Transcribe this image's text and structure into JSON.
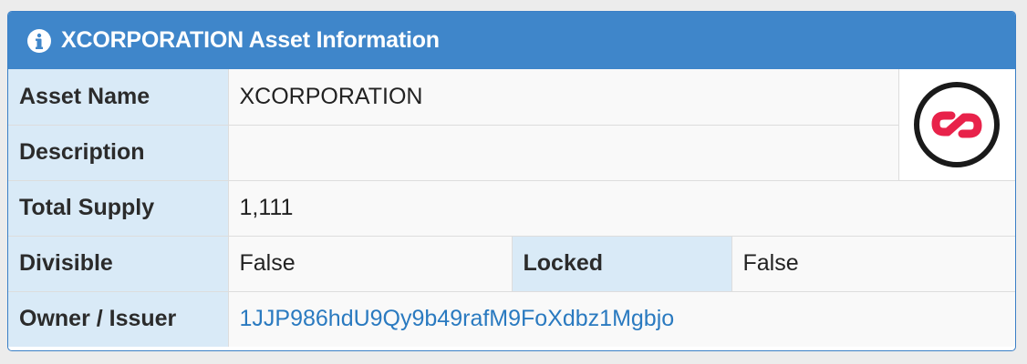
{
  "panel": {
    "title": "XCORPORATION Asset Information",
    "icon": "info-icon"
  },
  "rows": {
    "asset_name": {
      "label": "Asset Name",
      "value": "XCORPORATION"
    },
    "description": {
      "label": "Description",
      "value": ""
    },
    "total_supply": {
      "label": "Total Supply",
      "value": "1,111"
    },
    "divisible": {
      "label": "Divisible",
      "value": "False"
    },
    "locked": {
      "label": "Locked",
      "value": "False"
    },
    "owner": {
      "label": "Owner / Issuer",
      "value": "1JJP986hdU9Qy9b49rafM9FoXdbz1Mgbjo"
    }
  },
  "logo": {
    "icon": "asset-logo-icon",
    "color": "#e8224a"
  },
  "colors": {
    "header": "#3f86ca",
    "label_bg": "#d9eaf7",
    "link": "#2a7ac0"
  }
}
